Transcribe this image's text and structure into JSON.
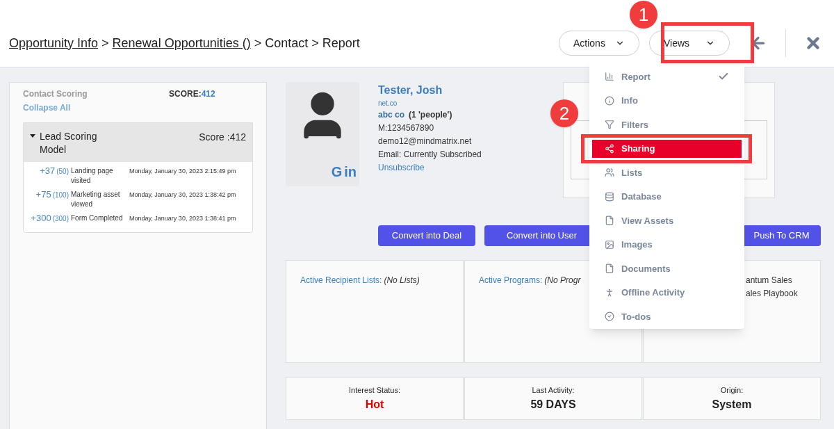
{
  "breadcrumb": {
    "links": [
      "Opportunity Info",
      "Renewal Opportunities ()"
    ],
    "separator": ">",
    "rest": [
      "Contact",
      "Report"
    ]
  },
  "header_buttons": [
    {
      "label": "Actions",
      "kind": "dropdown"
    },
    {
      "label": "Views",
      "kind": "dropdown"
    }
  ],
  "contact_scoring": {
    "title": "Contact Scoring",
    "score_label": "SCORE:",
    "score": "412",
    "collapse": "Collapse All",
    "model": {
      "title": "Lead Scoring Model",
      "score": "Score :412",
      "expanded": true,
      "rows": [
        {
          "points": "+37",
          "max": "(50)",
          "event": "Landing page visited",
          "time": "Monday, January 30, 2023 2:15:49 pm"
        },
        {
          "points": "+75",
          "max": "(100)",
          "event": "Marketing asset viewed",
          "time": "Monday, January 30, 2023 1:38:42 pm"
        },
        {
          "points": "+300",
          "max": "(300)",
          "event": "Form Completed",
          "time": "Monday, January 30, 2023 1:38:41 pm"
        }
      ]
    }
  },
  "contact": {
    "name": "Tester, Josh",
    "domain": "net.co",
    "company": "abc co",
    "people": "(1 'people')",
    "mobile": "M:1234567890",
    "email": "demo12@mindmatrix.net",
    "email_status": "Email: Currently Subscribed",
    "unsubscribe": "Unsubscribe",
    "social": [
      "G",
      "in"
    ]
  },
  "action_buttons": [
    "Convert into Deal",
    "Convert into User",
    "Push To CRM"
  ],
  "info_cards": [
    {
      "label": "Active Recipient Lists:",
      "value": "(No Lists)"
    },
    {
      "label": "Active Programs:",
      "value": "(No Progr"
    },
    {
      "lines": [
        "antum Sales",
        "ales Playbook"
      ]
    }
  ],
  "stats": [
    {
      "label": "Interest Status:",
      "value": "Hot",
      "color": "#e00000"
    },
    {
      "label": "Last Activity:",
      "value": "59 DAYS",
      "color": "#222222"
    },
    {
      "label": "Origin:",
      "value": "System",
      "color": "#222222"
    }
  ],
  "views_menu": [
    {
      "label": "Report",
      "selected": true,
      "highlighted": false
    },
    {
      "label": "Info",
      "selected": false,
      "highlighted": false
    },
    {
      "label": "Filters",
      "selected": false,
      "highlighted": false
    },
    {
      "label": "Sharing",
      "selected": false,
      "highlighted": true
    },
    {
      "label": "Lists",
      "selected": false,
      "highlighted": false
    },
    {
      "label": "Database",
      "selected": false,
      "highlighted": false
    },
    {
      "label": "View Assets",
      "selected": false,
      "highlighted": false
    },
    {
      "label": "Images",
      "selected": false,
      "highlighted": false
    },
    {
      "label": "Documents",
      "selected": false,
      "highlighted": false
    },
    {
      "label": "Offline Activity",
      "selected": false,
      "highlighted": false
    },
    {
      "label": "To-dos",
      "selected": false,
      "highlighted": false
    }
  ],
  "annotations": [
    "1",
    "2"
  ]
}
